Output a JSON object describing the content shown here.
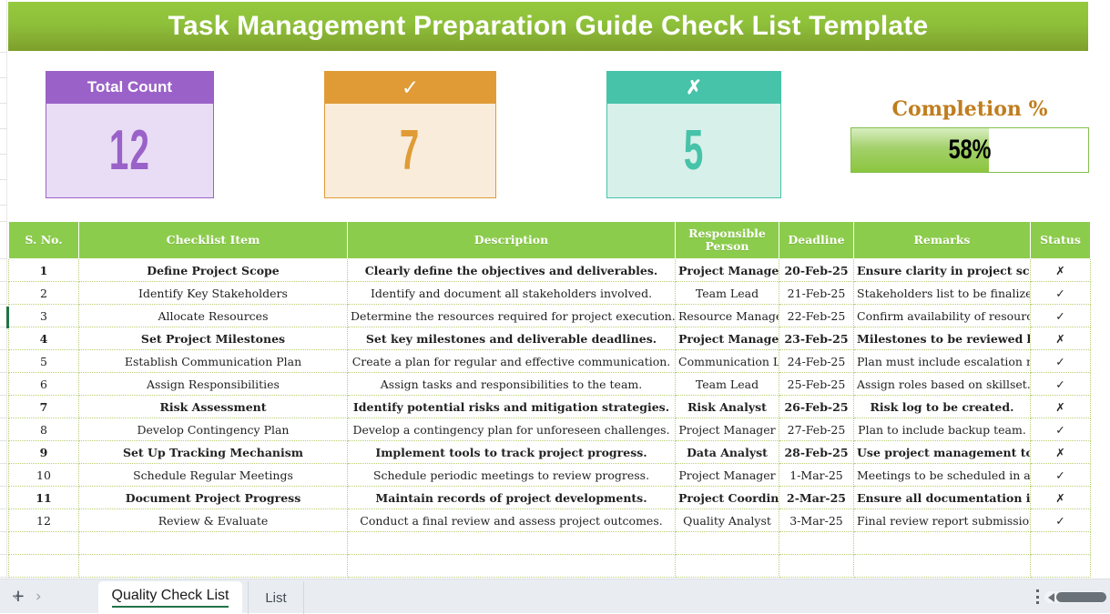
{
  "title": "Task Management Preparation Guide Check List Template",
  "kpis": [
    {
      "name": "total-count",
      "label": "Total Count",
      "value": "12",
      "header_color": "#9A62C8",
      "body_color": "#E9DDF5"
    },
    {
      "name": "completed",
      "label": "✓",
      "value": "7",
      "header_color": "#E09B36",
      "body_color": "#F9ECDA"
    },
    {
      "name": "pending",
      "label": "✗",
      "value": "5",
      "header_color": "#46C3A9",
      "body_color": "#D8F0EA"
    }
  ],
  "completion": {
    "label": "Completion %",
    "value": "58%",
    "percent": 58,
    "label_color": "#C07D1E",
    "fill_color": "#8CC63F"
  },
  "table": {
    "headers": [
      "S. No.",
      "Checklist Item",
      "Description",
      "Responsible Person",
      "Deadline",
      "Remarks",
      "Status"
    ],
    "header_bg": "#8CCC4C",
    "highlight_color": "#E8262D",
    "ok_color": "#1F9C3F",
    "rows": [
      {
        "no": "1",
        "item": "Define Project Scope",
        "desc": "Clearly define the objectives and deliverables.",
        "person": "Project Manager",
        "deadline": "20-Feb-25",
        "remarks": "Ensure clarity in project scope.",
        "status": "✗",
        "flag": "no",
        "highlight": true
      },
      {
        "no": "2",
        "item": "Identify Key Stakeholders",
        "desc": "Identify and document all stakeholders involved.",
        "person": "Team Lead",
        "deadline": "21-Feb-25",
        "remarks": "Stakeholders list to be finalized.",
        "status": "✓",
        "flag": "ok",
        "highlight": false
      },
      {
        "no": "3",
        "item": "Allocate Resources",
        "desc": "Determine the resources required for project execution.",
        "person": "Resource Manager",
        "deadline": "22-Feb-25",
        "remarks": "Confirm availability of resources.",
        "status": "✓",
        "flag": "ok",
        "highlight": false
      },
      {
        "no": "4",
        "item": "Set Project Milestones",
        "desc": "Set key milestones and deliverable deadlines.",
        "person": "Project Manager",
        "deadline": "23-Feb-25",
        "remarks": "Milestones to be reviewed by all teams.",
        "status": "✗",
        "flag": "no",
        "highlight": true
      },
      {
        "no": "5",
        "item": "Establish Communication Plan",
        "desc": "Create a plan for regular and effective communication.",
        "person": "Communication Lead",
        "deadline": "24-Feb-25",
        "remarks": "Plan must include escalation matrix.",
        "status": "✓",
        "flag": "ok",
        "highlight": false
      },
      {
        "no": "6",
        "item": "Assign Responsibilities",
        "desc": "Assign tasks and responsibilities to the team.",
        "person": "Team Lead",
        "deadline": "25-Feb-25",
        "remarks": "Assign roles based on skillset.",
        "status": "✓",
        "flag": "ok",
        "highlight": false
      },
      {
        "no": "7",
        "item": "Risk Assessment",
        "desc": "Identify potential risks and mitigation strategies.",
        "person": "Risk Analyst",
        "deadline": "26-Feb-25",
        "remarks": "Risk log to be created.",
        "status": "✗",
        "flag": "no",
        "highlight": true
      },
      {
        "no": "8",
        "item": "Develop Contingency Plan",
        "desc": "Develop a contingency plan for unforeseen challenges.",
        "person": "Project Manager",
        "deadline": "27-Feb-25",
        "remarks": "Plan to include backup team.",
        "status": "✓",
        "flag": "ok",
        "highlight": false
      },
      {
        "no": "9",
        "item": "Set Up Tracking Mechanism",
        "desc": "Implement tools to track project progress.",
        "person": "Data Analyst",
        "deadline": "28-Feb-25",
        "remarks": "Use project management tool.",
        "status": "✗",
        "flag": "no",
        "highlight": true
      },
      {
        "no": "10",
        "item": "Schedule Regular Meetings",
        "desc": "Schedule periodic meetings to review progress.",
        "person": "Project Manager",
        "deadline": "1-Mar-25",
        "remarks": "Meetings to be scheduled in advance.",
        "status": "✓",
        "flag": "ok",
        "highlight": false
      },
      {
        "no": "11",
        "item": "Document Project Progress",
        "desc": "Maintain records of project developments.",
        "person": "Project Coordinator",
        "deadline": "2-Mar-25",
        "remarks": "Ensure all documentation is updated.",
        "status": "✗",
        "flag": "no",
        "highlight": true
      },
      {
        "no": "12",
        "item": "Review & Evaluate",
        "desc": "Conduct a final review and assess project outcomes.",
        "person": "Quality Analyst",
        "deadline": "3-Mar-25",
        "remarks": "Final review report submission.",
        "status": "✓",
        "flag": "ok",
        "highlight": false
      }
    ],
    "empty_rows": 2
  },
  "tabbar": {
    "prev_arrow": "‹",
    "next_arrow": "›",
    "tabs": [
      {
        "label": "Quality Check List",
        "active": true
      },
      {
        "label": "List",
        "active": false
      }
    ],
    "add_tab": "+",
    "accent_color": "#217346"
  }
}
